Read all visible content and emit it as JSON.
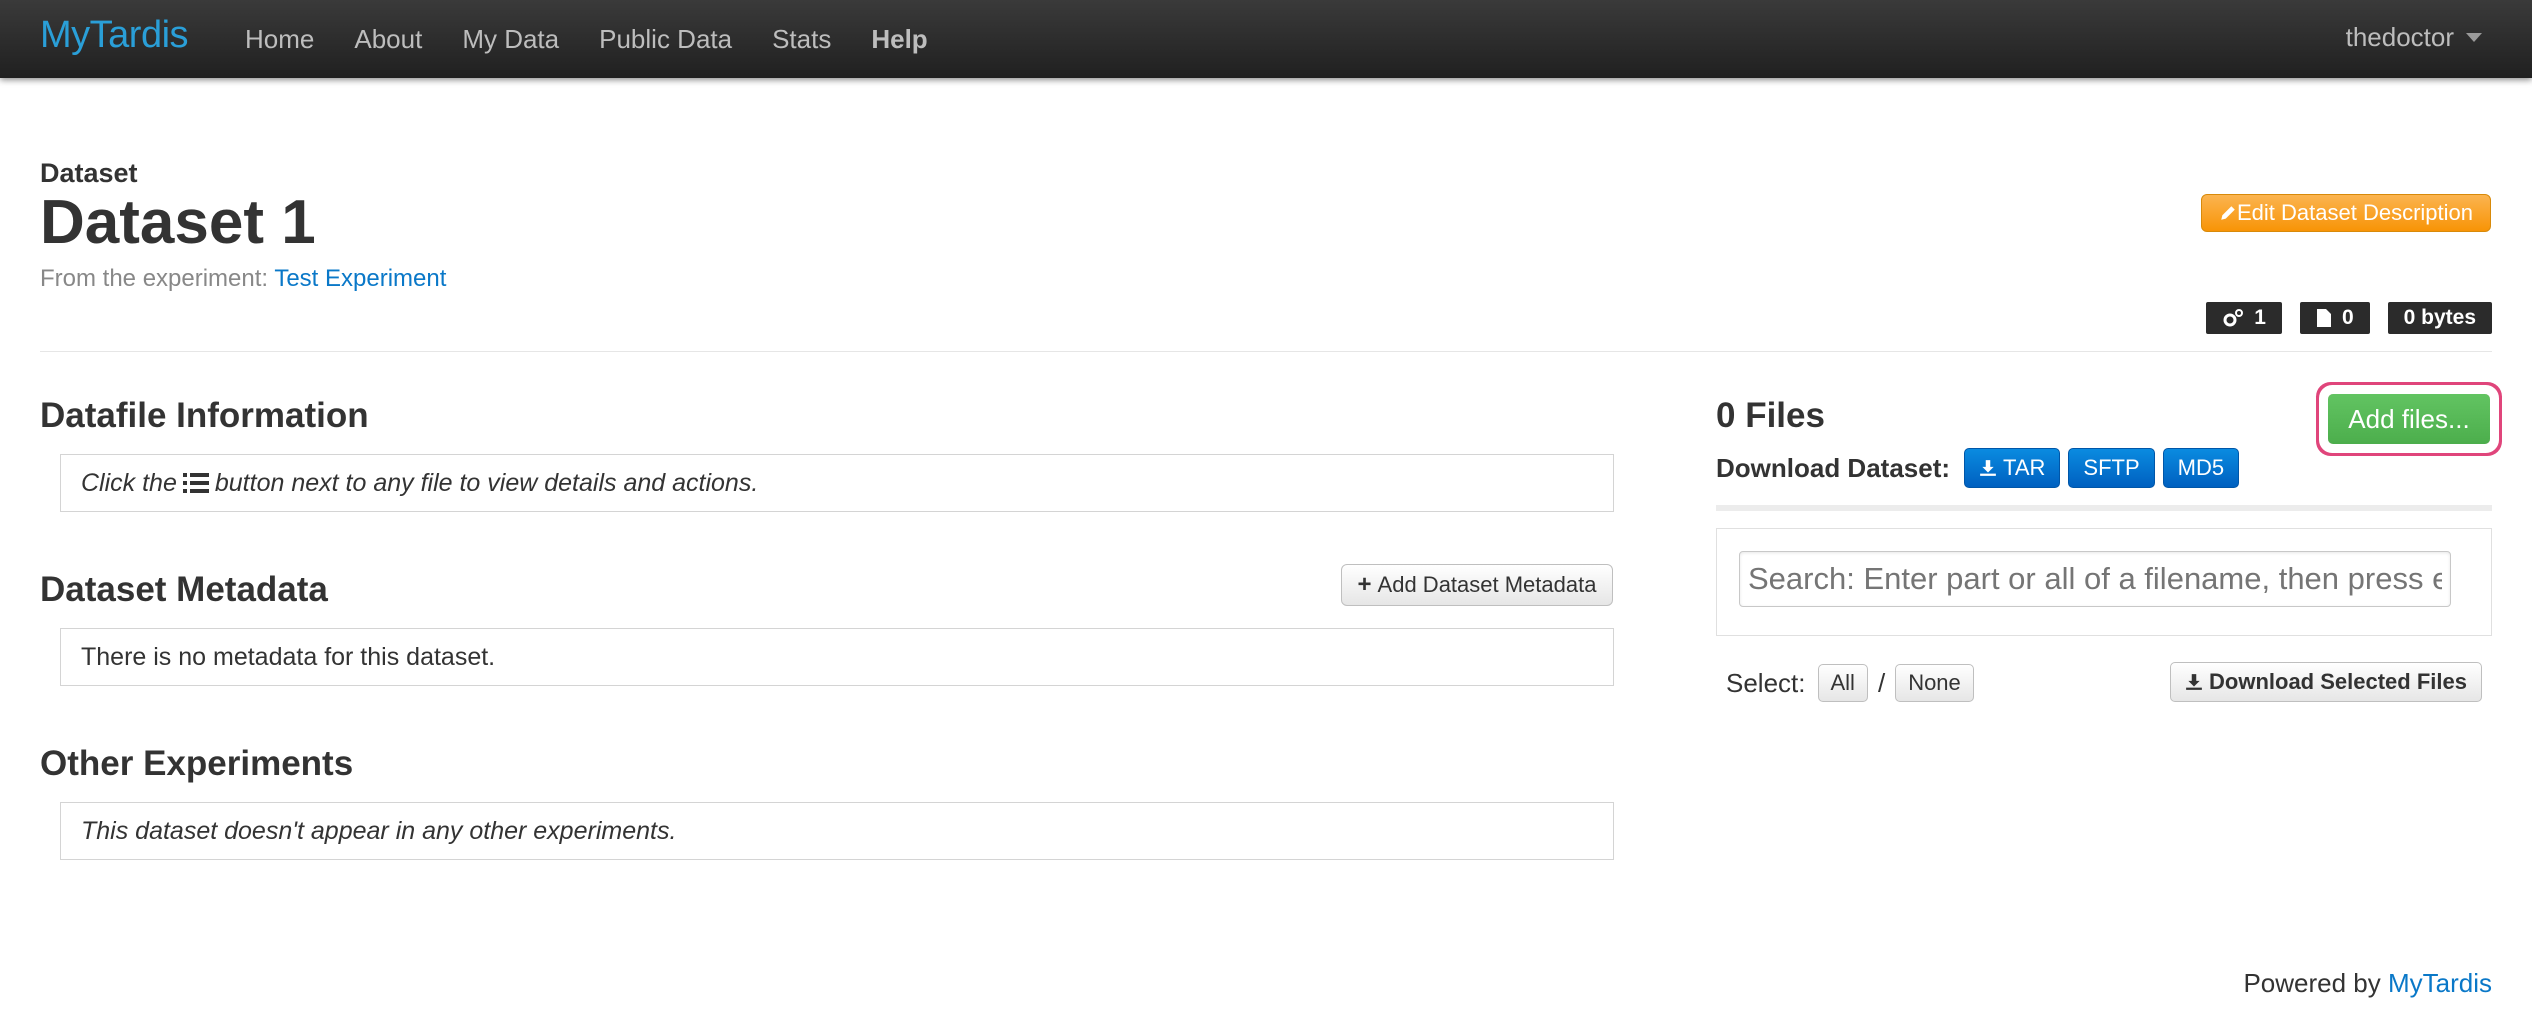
{
  "navbar": {
    "brand": "MyTardis",
    "links": [
      "Home",
      "About",
      "My Data",
      "Public Data",
      "Stats",
      "Help"
    ],
    "user": "thedoctor"
  },
  "header": {
    "label": "Dataset",
    "title": "Dataset 1",
    "from_prefix": "From the experiment:",
    "experiment_link": "Test Experiment",
    "edit_button": "Edit Dataset Description"
  },
  "stats": {
    "experiments": "1",
    "files": "0",
    "size": "0 bytes"
  },
  "datafile_info": {
    "title": "Datafile Information",
    "text_before": "Click the",
    "text_after": "button next to any file to view details and actions."
  },
  "metadata": {
    "title": "Dataset Metadata",
    "add_button": "Add Dataset Metadata",
    "empty_text": "There is no metadata for this dataset."
  },
  "other_experiments": {
    "title": "Other Experiments",
    "empty_text": "This dataset doesn't appear in any other experiments."
  },
  "files_panel": {
    "count": "0 Files",
    "add_files": "Add files...",
    "download_label": "Download Dataset:",
    "download_buttons": [
      "TAR",
      "SFTP",
      "MD5"
    ],
    "search_placeholder": "Search: Enter part or all of a filename, then press enter",
    "select_label": "Select:",
    "select_all": "All",
    "select_none": "None",
    "download_selected": "Download Selected Files"
  },
  "footer": {
    "prefix": "Powered by",
    "link": "MyTardis"
  },
  "colors": {
    "brand": "#2a9fd8",
    "link": "#0a78c8",
    "edit_button": "#f89406",
    "add_files": "#5cb85c",
    "download_buttons": "#0070d0",
    "highlight": "#e0457b"
  }
}
